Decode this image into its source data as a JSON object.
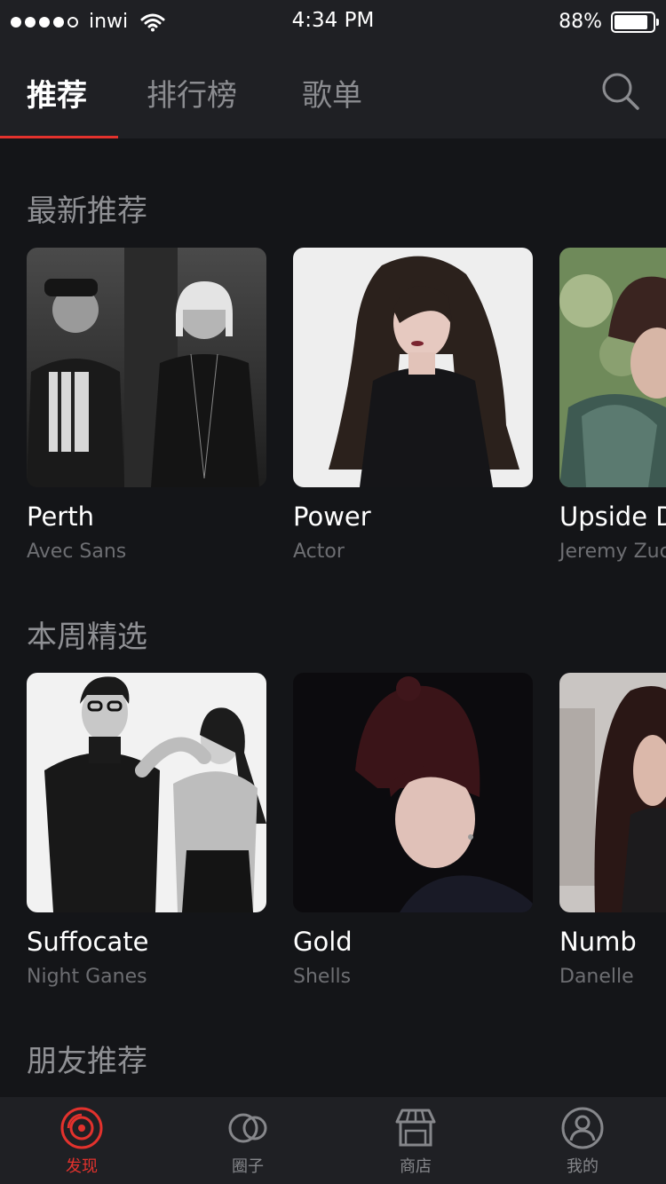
{
  "status": {
    "carrier": "inwi",
    "time": "4:34 PM",
    "battery": "88%",
    "battery_level": 0.88
  },
  "nav": {
    "tabs": [
      {
        "label": "推荐"
      },
      {
        "label": "排行榜"
      },
      {
        "label": "歌单"
      }
    ],
    "active_tab": 0,
    "search_icon": "search-icon"
  },
  "sections": [
    {
      "title": "最新推荐",
      "items": [
        {
          "title": "Perth",
          "artist": "Avec Sans"
        },
        {
          "title": "Power",
          "artist": "Actor"
        },
        {
          "title": "Upside Down",
          "artist": "Jeremy Zucker"
        }
      ]
    },
    {
      "title": "本周精选",
      "items": [
        {
          "title": "Suffocate",
          "artist": "Night Ganes"
        },
        {
          "title": "Gold",
          "artist": "Shells"
        },
        {
          "title": "Numb",
          "artist": "Danelle"
        }
      ]
    },
    {
      "title": "朋友推荐",
      "items": []
    }
  ],
  "bottom_bar": {
    "items": [
      {
        "label": "发现",
        "icon": "disc-icon"
      },
      {
        "label": "圈子",
        "icon": "circles-icon"
      },
      {
        "label": "商店",
        "icon": "store-icon"
      },
      {
        "label": "我的",
        "icon": "user-icon"
      }
    ],
    "active": 0
  },
  "colors": {
    "accent": "#e3322d",
    "background": "#141518",
    "bar": "#1f2024"
  }
}
